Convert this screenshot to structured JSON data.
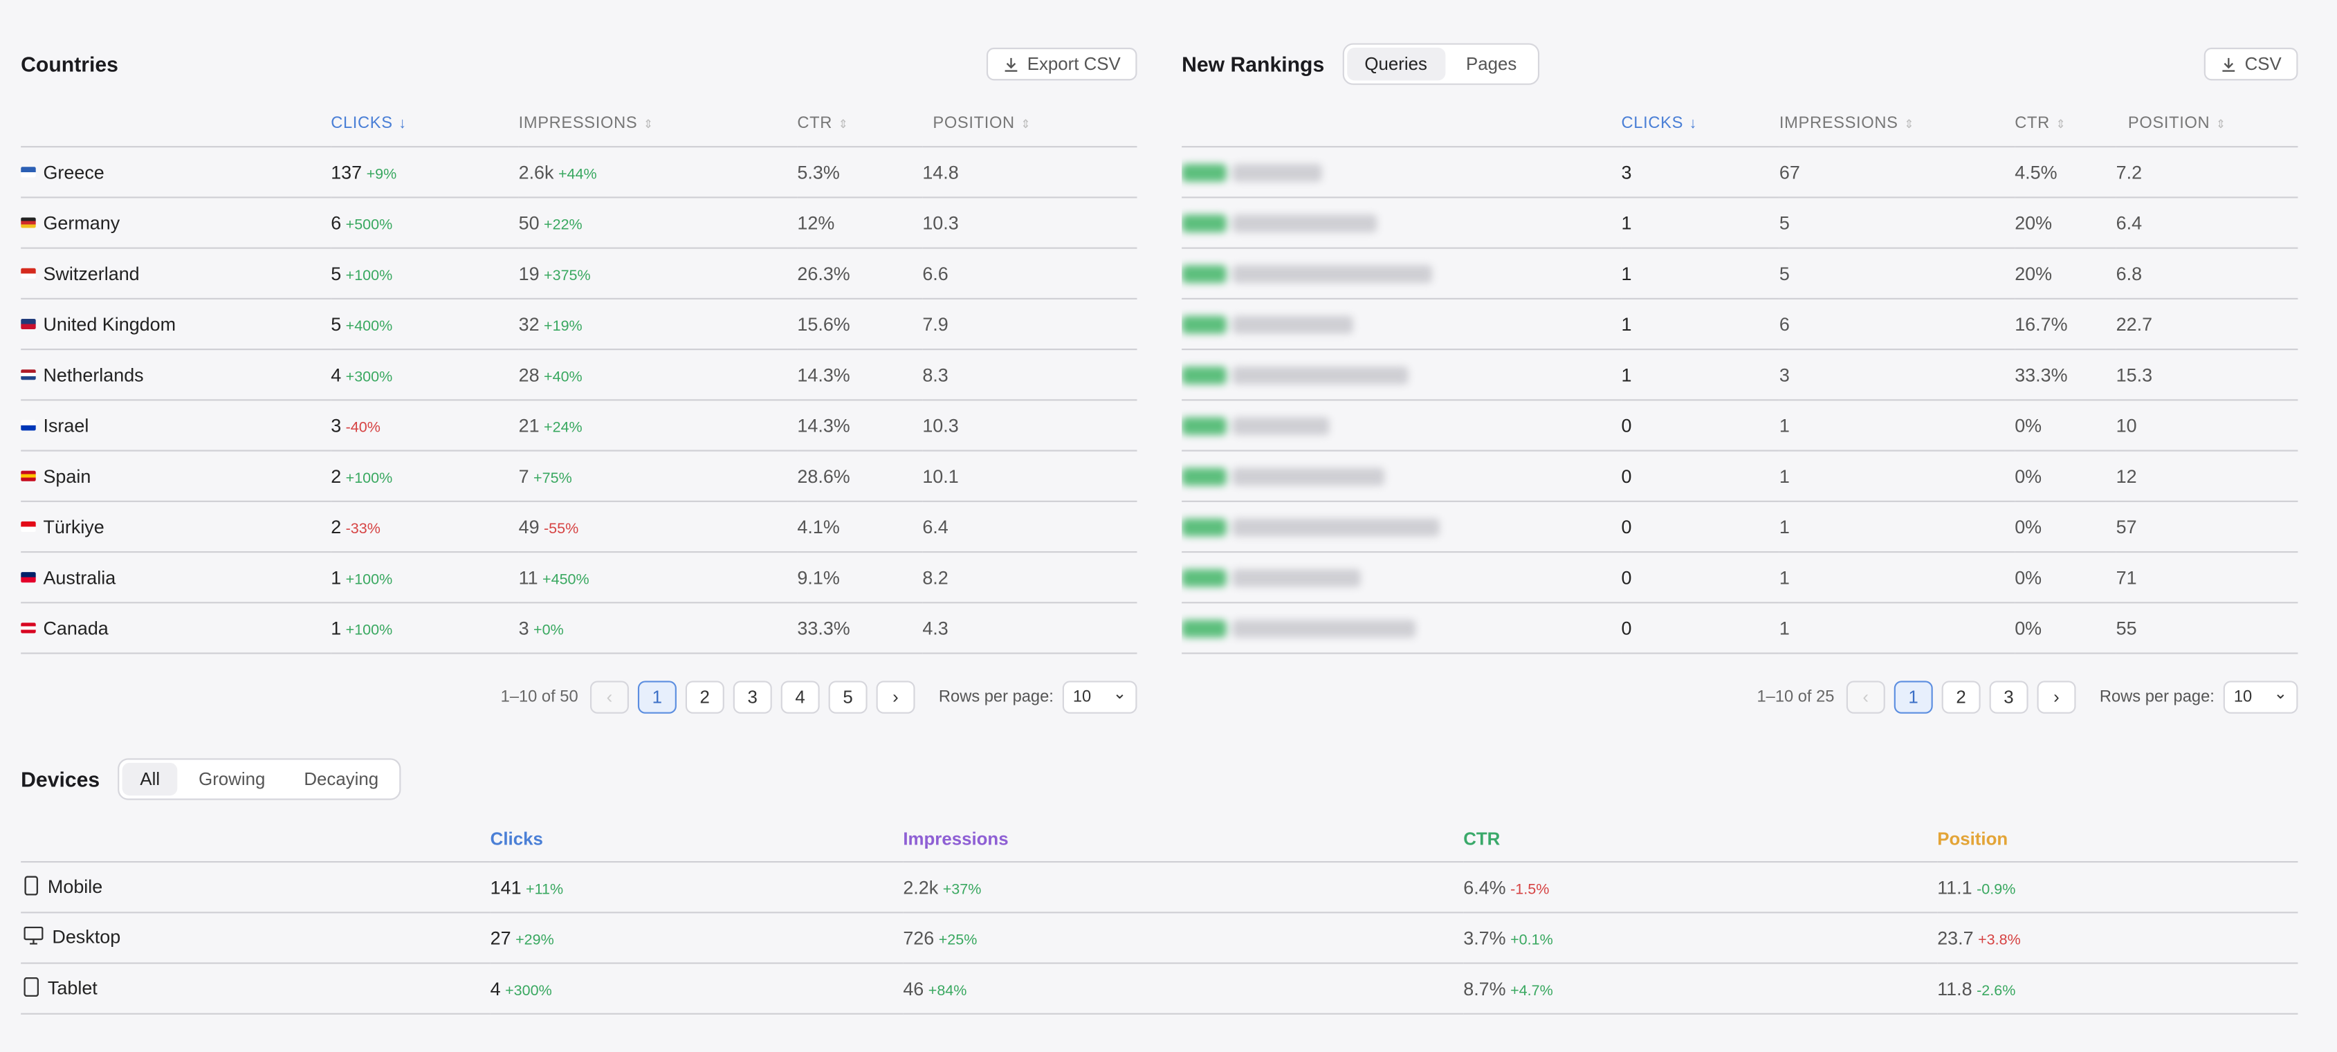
{
  "countries": {
    "title": "Countries",
    "export_label": "Export CSV",
    "columns": [
      "",
      "Clicks",
      "Impressions",
      "CTR",
      "Position"
    ],
    "rows": [
      {
        "name": "Greece",
        "flag": [
          "#2b5fb4",
          "#ffffff"
        ],
        "clicks": "137",
        "clicks_d": "+9%",
        "clicks_t": "pos",
        "impr": "2.6k",
        "impr_d": "+44%",
        "impr_t": "pos",
        "ctr": "5.3%",
        "pos": "14.8"
      },
      {
        "name": "Germany",
        "flag": [
          "#222222",
          "#d02a2a",
          "#f2c01e"
        ],
        "clicks": "6",
        "clicks_d": "+500%",
        "clicks_t": "pos",
        "impr": "50",
        "impr_d": "+22%",
        "impr_t": "pos",
        "ctr": "12%",
        "pos": "10.3"
      },
      {
        "name": "Switzerland",
        "flag": [
          "#d52b1e",
          "#ffffff"
        ],
        "clicks": "5",
        "clicks_d": "+100%",
        "clicks_t": "pos",
        "impr": "19",
        "impr_d": "+375%",
        "impr_t": "pos",
        "ctr": "26.3%",
        "pos": "6.6"
      },
      {
        "name": "United Kingdom",
        "flag": [
          "#1f3a7a",
          "#c8102e"
        ],
        "clicks": "5",
        "clicks_d": "+400%",
        "clicks_t": "pos",
        "impr": "32",
        "impr_d": "+19%",
        "impr_t": "pos",
        "ctr": "15.6%",
        "pos": "7.9"
      },
      {
        "name": "Netherlands",
        "flag": [
          "#ae1c28",
          "#ffffff",
          "#21468b"
        ],
        "clicks": "4",
        "clicks_d": "+300%",
        "clicks_t": "pos",
        "impr": "28",
        "impr_d": "+40%",
        "impr_t": "pos",
        "ctr": "14.3%",
        "pos": "8.3"
      },
      {
        "name": "Israel",
        "flag": [
          "#ffffff",
          "#0038b8"
        ],
        "clicks": "3",
        "clicks_d": "-40%",
        "clicks_t": "neg",
        "impr": "21",
        "impr_d": "+24%",
        "impr_t": "pos",
        "ctr": "14.3%",
        "pos": "10.3"
      },
      {
        "name": "Spain",
        "flag": [
          "#c60b1e",
          "#ffc400",
          "#c60b1e"
        ],
        "clicks": "2",
        "clicks_d": "+100%",
        "clicks_t": "pos",
        "impr": "7",
        "impr_d": "+75%",
        "impr_t": "pos",
        "ctr": "28.6%",
        "pos": "10.1"
      },
      {
        "name": "Türkiye",
        "flag": [
          "#e30a17",
          "#ffffff"
        ],
        "clicks": "2",
        "clicks_d": "-33%",
        "clicks_t": "neg",
        "impr": "49",
        "impr_d": "-55%",
        "impr_t": "neg",
        "ctr": "4.1%",
        "pos": "6.4"
      },
      {
        "name": "Australia",
        "flag": [
          "#012169",
          "#e4002b"
        ],
        "clicks": "1",
        "clicks_d": "+100%",
        "clicks_t": "pos",
        "impr": "11",
        "impr_d": "+450%",
        "impr_t": "pos",
        "ctr": "9.1%",
        "pos": "8.2"
      },
      {
        "name": "Canada",
        "flag": [
          "#d80621",
          "#ffffff",
          "#d80621"
        ],
        "clicks": "1",
        "clicks_d": "+100%",
        "clicks_t": "pos",
        "impr": "3",
        "impr_d": "+0%",
        "impr_t": "pos",
        "ctr": "33.3%",
        "pos": "4.3"
      }
    ],
    "pager": {
      "info": "1–10 of 50",
      "pages": [
        "1",
        "2",
        "3",
        "4",
        "5"
      ],
      "active": "1",
      "rows_label": "Rows per page:",
      "rows_value": "10"
    }
  },
  "rankings": {
    "title": "New Rankings",
    "tabs": [
      "Queries",
      "Pages"
    ],
    "active_tab": "Queries",
    "export_label": "CSV",
    "columns": [
      "",
      "Clicks",
      "Impressions",
      "CTR",
      "Position"
    ],
    "rows": [
      {
        "clicks": "3",
        "impr": "67",
        "ctr": "4.5%",
        "pos": "7.2"
      },
      {
        "clicks": "1",
        "impr": "5",
        "ctr": "20%",
        "pos": "6.4"
      },
      {
        "clicks": "1",
        "impr": "5",
        "ctr": "20%",
        "pos": "6.8"
      },
      {
        "clicks": "1",
        "impr": "6",
        "ctr": "16.7%",
        "pos": "22.7"
      },
      {
        "clicks": "1",
        "impr": "3",
        "ctr": "33.3%",
        "pos": "15.3"
      },
      {
        "clicks": "0",
        "impr": "1",
        "ctr": "0%",
        "pos": "10"
      },
      {
        "clicks": "0",
        "impr": "1",
        "ctr": "0%",
        "pos": "12"
      },
      {
        "clicks": "0",
        "impr": "1",
        "ctr": "0%",
        "pos": "57"
      },
      {
        "clicks": "0",
        "impr": "1",
        "ctr": "0%",
        "pos": "71"
      },
      {
        "clicks": "0",
        "impr": "1",
        "ctr": "0%",
        "pos": "55"
      }
    ],
    "pager": {
      "info": "1–10 of 25",
      "pages": [
        "1",
        "2",
        "3"
      ],
      "active": "1",
      "rows_label": "Rows per page:",
      "rows_value": "10"
    }
  },
  "devices": {
    "title": "Devices",
    "tabs": [
      "All",
      "Growing",
      "Decaying"
    ],
    "active_tab": "All",
    "columns": [
      "",
      "Clicks",
      "Impressions",
      "CTR",
      "Position"
    ],
    "rows": [
      {
        "name": "Mobile",
        "icon": "mobile-icon",
        "clicks": "141",
        "clicks_d": "+11%",
        "clicks_t": "pos",
        "impr": "2.2k",
        "impr_d": "+37%",
        "impr_t": "pos",
        "ctr": "6.4%",
        "ctr_d": "-1.5%",
        "ctr_t": "neg",
        "pos": "11.1",
        "pos_d": "-0.9%",
        "pos_t": "pos"
      },
      {
        "name": "Desktop",
        "icon": "desktop-icon",
        "clicks": "27",
        "clicks_d": "+29%",
        "clicks_t": "pos",
        "impr": "726",
        "impr_d": "+25%",
        "impr_t": "pos",
        "ctr": "3.7%",
        "ctr_d": "+0.1%",
        "ctr_t": "pos",
        "pos": "23.7",
        "pos_d": "+3.8%",
        "pos_t": "neg"
      },
      {
        "name": "Tablet",
        "icon": "tablet-icon",
        "clicks": "4",
        "clicks_d": "+300%",
        "clicks_t": "pos",
        "impr": "46",
        "impr_d": "+84%",
        "impr_t": "pos",
        "ctr": "8.7%",
        "ctr_d": "+4.7%",
        "ctr_t": "pos",
        "pos": "11.8",
        "pos_d": "-2.6%",
        "pos_t": "pos"
      }
    ]
  }
}
